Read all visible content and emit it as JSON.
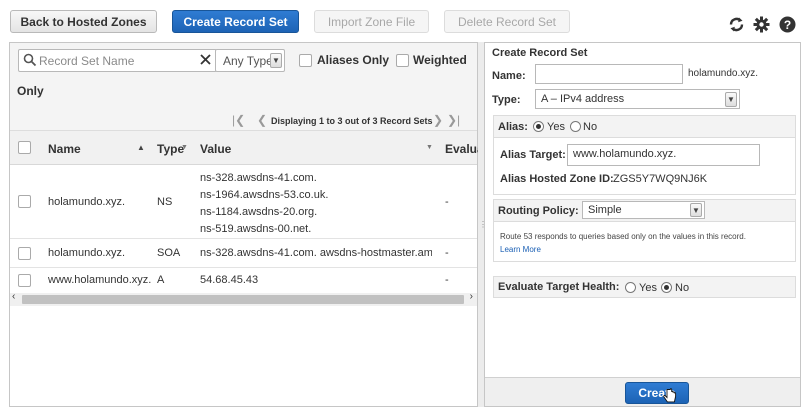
{
  "toolbar": {
    "back_label": "Back to Hosted Zones",
    "create_label": "Create Record Set",
    "import_label": "Import Zone File",
    "delete_label": "Delete Record Set",
    "icons": [
      "refresh-icon",
      "gear-icon",
      "help-icon"
    ]
  },
  "filter": {
    "search_placeholder": "Record Set Name",
    "type_value": "Any Type",
    "aliases_only_label": "Aliases Only",
    "weighted_label": "Weighted",
    "weighted_wrap": "Only",
    "pagination_text": "Displaying 1 to 3 out of 3 Record Sets"
  },
  "table": {
    "columns": [
      "Name",
      "Type",
      "Value",
      "Evalua"
    ],
    "rows": [
      {
        "name": "holamundo.xyz.",
        "type": "NS",
        "values": [
          "ns-328.awsdns-41.com.",
          "ns-1964.awsdns-53.co.uk.",
          "ns-1184.awsdns-20.org.",
          "ns-519.awsdns-00.net."
        ],
        "eval": "-"
      },
      {
        "name": "holamundo.xyz.",
        "type": "SOA",
        "values": [
          "ns-328.awsdns-41.com. awsdns-hostmaster.amazor"
        ],
        "eval": "-"
      },
      {
        "name": "www.holamundo.xyz.",
        "type": "A",
        "values": [
          "54.68.45.43"
        ],
        "eval": "-"
      }
    ]
  },
  "form": {
    "title": "Create Record Set",
    "name_label": "Name:",
    "name_value": "",
    "name_suffix": "holamundo.xyz.",
    "type_label": "Type:",
    "type_value": "A – IPv4 address",
    "alias_label": "Alias:",
    "alias_yes": "Yes",
    "alias_no": "No",
    "alias_target_label": "Alias Target:",
    "alias_target_value": "www.holamundo.xyz.",
    "alias_zone_label": "Alias Hosted Zone ID:",
    "alias_zone_value": "ZGS5Y7WQ9NJ6K",
    "routing_label": "Routing Policy:",
    "routing_value": "Simple",
    "routing_help": "Route 53 responds to queries based only on the values in this record.",
    "learn_more": "Learn More",
    "eval_label": "Evaluate Target Health:",
    "eval_yes": "Yes",
    "eval_no": "No",
    "create_button": "Create"
  }
}
